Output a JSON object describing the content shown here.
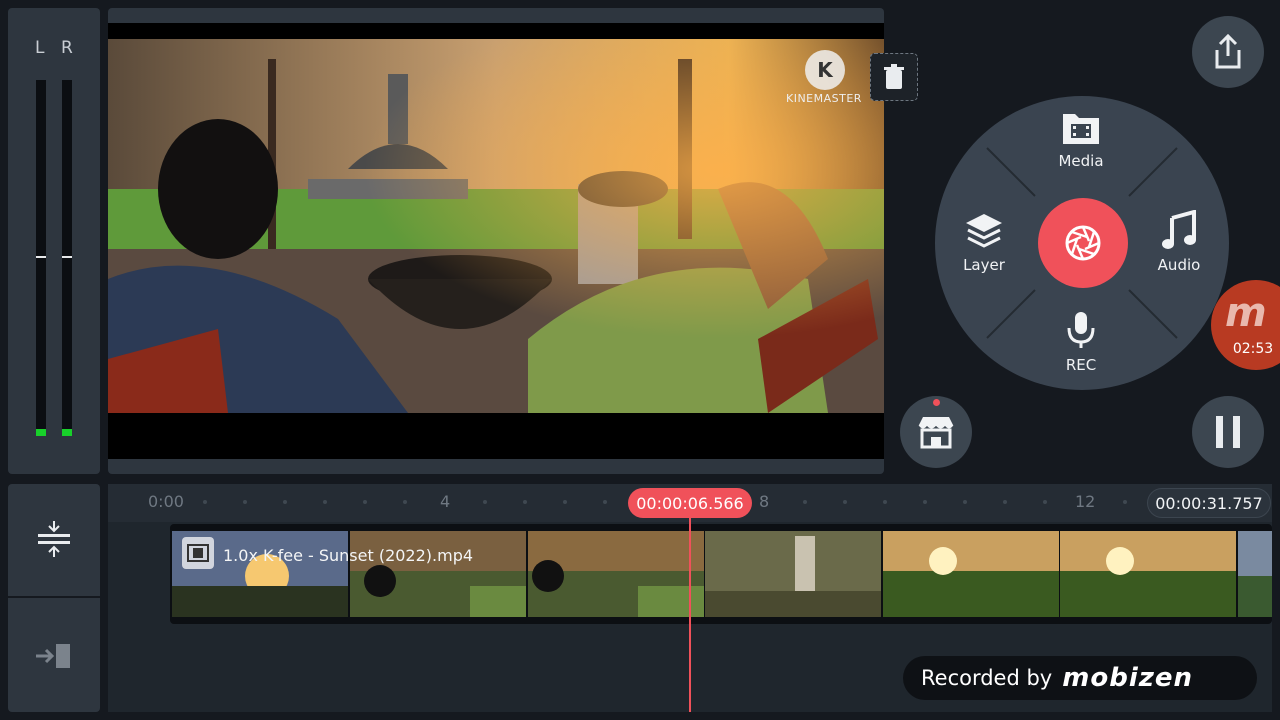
{
  "meter": {
    "left_label": "L",
    "right_label": "R",
    "left_level": 0.02,
    "right_level": 0.02
  },
  "preview": {
    "watermark_text": "KINEMASTER",
    "watermark_logo": "K",
    "delete_icon": "trash-icon"
  },
  "dial": {
    "media_label": "Media",
    "layer_label": "Layer",
    "audio_label": "Audio",
    "rec_label": "REC",
    "capture_icon": "camera-shutter-icon"
  },
  "controls": {
    "export_icon": "share-icon",
    "store_icon": "store-icon",
    "pause_icon": "pause-icon"
  },
  "mobizen": {
    "time": "02:53"
  },
  "timeline": {
    "ticks": [
      "0:00",
      "4",
      "8",
      "12"
    ],
    "playhead_time": "00:00:06.566",
    "total_duration": "00:00:31.757",
    "clip_name": "1.0x K-fee - Sunset (2022).mp4"
  },
  "recorded_banner": {
    "text": "Recorded by",
    "brand": "mobizen"
  },
  "colors": {
    "accent": "#f0515a",
    "panel": "#2e363f",
    "background": "#15191f",
    "meter_green": "#18d12a"
  }
}
